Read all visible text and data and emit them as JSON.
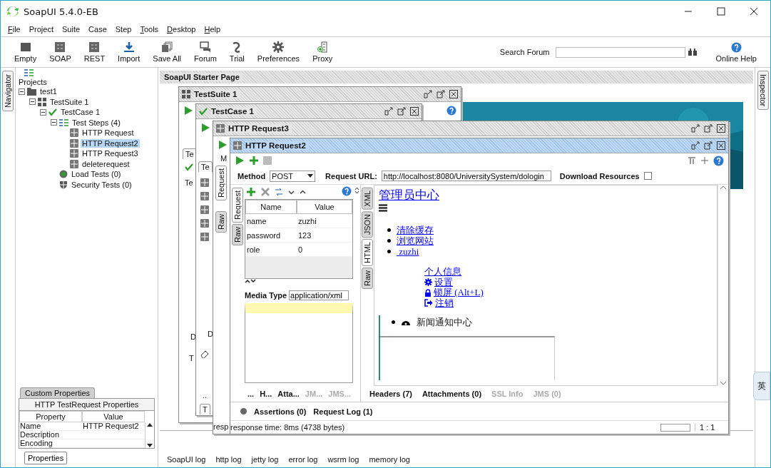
{
  "window": {
    "title": "SoapUI 5.4.0-EB"
  },
  "menu": [
    {
      "label": "File",
      "mnemonic": true
    },
    {
      "label": "Project",
      "mnemonic": false
    },
    {
      "label": "Suite",
      "mnemonic": false
    },
    {
      "label": "Case",
      "mnemonic": false
    },
    {
      "label": "Step",
      "mnemonic": false
    },
    {
      "label": "Tools",
      "mnemonic": true
    },
    {
      "label": "Desktop",
      "mnemonic": true
    },
    {
      "label": "Help",
      "mnemonic": true
    }
  ],
  "toolbar": {
    "buttons": [
      "Empty",
      "SOAP",
      "REST",
      "Import",
      "Save All",
      "Forum",
      "Trial",
      "Preferences",
      "Proxy"
    ],
    "search_label": "Search Forum",
    "help_label": "Online Help"
  },
  "navigator": {
    "tab": "Navigator",
    "header": "Projects",
    "tree": [
      {
        "label": "test1",
        "kind": "project",
        "selected": false,
        "expanded": true,
        "children": [
          {
            "label": "TestSuite 1",
            "kind": "suite",
            "selected": false,
            "expanded": true,
            "children": [
              {
                "label": "TestCase 1",
                "kind": "case",
                "selected": false,
                "expanded": true,
                "children": [
                  {
                    "label": "Test Steps (4)",
                    "kind": "steps",
                    "selected": false,
                    "expanded": true,
                    "children": [
                      {
                        "label": "HTTP Request",
                        "kind": "step",
                        "selected": false
                      },
                      {
                        "label": "HTTP Request2",
                        "kind": "step",
                        "selected": true
                      },
                      {
                        "label": "HTTP Request3",
                        "kind": "step",
                        "selected": false
                      },
                      {
                        "label": "deleterequest",
                        "kind": "step",
                        "selected": false
                      }
                    ]
                  },
                  {
                    "label": "Load Tests (0)",
                    "kind": "load",
                    "selected": false
                  },
                  {
                    "label": "Security Tests (0)",
                    "kind": "security",
                    "selected": false
                  }
                ]
              }
            ]
          }
        ]
      }
    ],
    "properties": {
      "tab": "Custom Properties",
      "title": "HTTP TestRequest Properties",
      "columns": [
        "Property",
        "Value"
      ],
      "rows": [
        {
          "property": "Name",
          "value": "HTTP Request2"
        },
        {
          "property": "Description"
        },
        {
          "property": "Encoding"
        }
      ]
    },
    "button": "Properties"
  },
  "inspector_tab": "Inspector",
  "desktop": {
    "title": "SoapUI Starter Page",
    "windows": [
      {
        "kind": "suite",
        "title": "TestSuite 1",
        "active": false,
        "fragments": [
          "Te",
          "Te",
          "D",
          "T"
        ]
      },
      {
        "kind": "case",
        "title": "TestCase 1",
        "active": false,
        "fragments": [
          "Te",
          "D",
          "..",
          "T"
        ]
      },
      {
        "kind": "request",
        "title": "HTTP Request3",
        "active": false,
        "fragments": [
          "M",
          "Request",
          "Raw",
          "resp"
        ]
      }
    ],
    "editor": {
      "title": "HTTP Request2",
      "active": true,
      "method_label": "Method",
      "method": "POST",
      "url_label": "Request URL:",
      "url": "http://localhost:8080/UniversitySystem/dologin",
      "download_label": "Download Resources",
      "download_checked": false,
      "request_tabs": [
        {
          "label": "Request",
          "selected": true
        },
        {
          "label": "Raw",
          "selected": false
        }
      ],
      "param_columns": [
        "Name",
        "Value"
      ],
      "params": [
        {
          "name": "name",
          "value": "zuzhi"
        },
        {
          "name": "password",
          "value": "123"
        },
        {
          "name": "role",
          "value": "0"
        }
      ],
      "media_label": "Media Type",
      "media_type": "application/xml",
      "request_bottom_tabs": [
        {
          "label": "...",
          "disabled": false
        },
        {
          "label": "H...",
          "disabled": false
        },
        {
          "label": "Atta...",
          "disabled": false
        },
        {
          "label": "JM...",
          "disabled": true
        },
        {
          "label": "JMS...",
          "disabled": true
        }
      ],
      "response_tabs": [
        {
          "label": "XML",
          "selected": false
        },
        {
          "label": "JSON",
          "selected": false
        },
        {
          "label": "HTML",
          "selected": true
        },
        {
          "label": "Raw",
          "selected": false
        }
      ],
      "html": {
        "heading": "管理员中心",
        "links": [
          "清除缓存",
          "浏览网站",
          " zuzhi"
        ],
        "submenu": [
          "个人信息",
          "设置",
          "锁屏 (Alt+L)",
          "注销"
        ],
        "news": "新闻通知中心"
      },
      "response_bottom_tabs": [
        {
          "label": "Headers (7)",
          "disabled": false
        },
        {
          "label": "Attachments (0)",
          "disabled": false
        },
        {
          "label": "SSL Info",
          "disabled": true
        },
        {
          "label": "JMS (0)",
          "disabled": true
        }
      ],
      "footer_tabs": [
        "Assertions (0)",
        "Request Log (1)"
      ],
      "status": "response time: 8ms (4738 bytes)",
      "position": "1 : 1"
    }
  },
  "log_tabs": [
    "SoapUI log",
    "http log",
    "jetty log",
    "error log",
    "wsrm log",
    "memory log"
  ],
  "ime_badge": "英"
}
